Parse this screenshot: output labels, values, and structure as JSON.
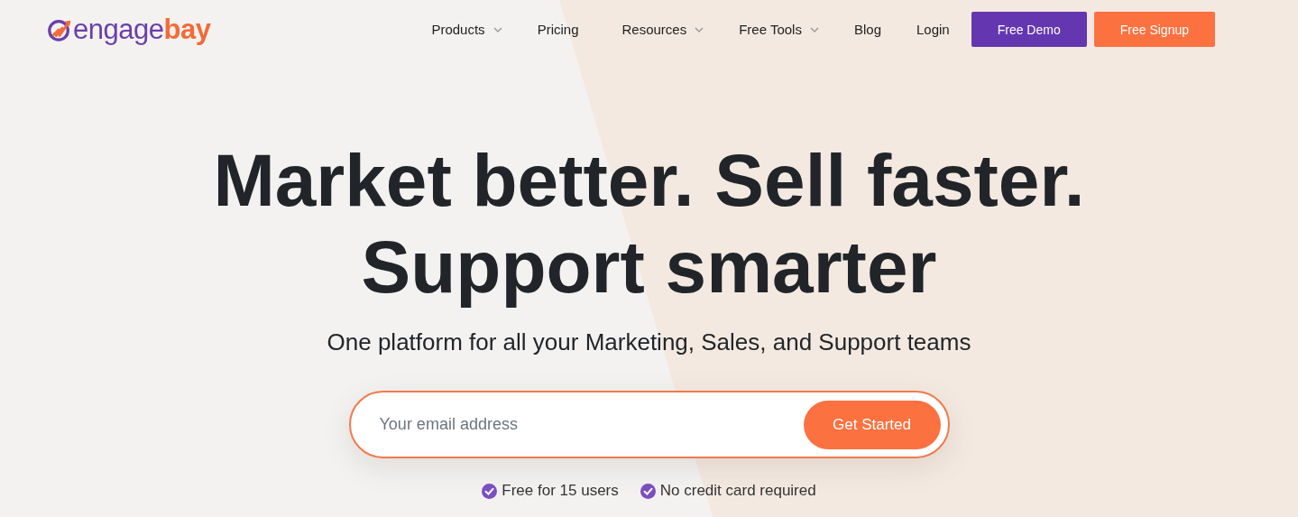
{
  "logo": {
    "first": "engage",
    "second": "bay"
  },
  "nav": [
    {
      "label": "Products",
      "kind": "dropdown"
    },
    {
      "label": "Pricing",
      "kind": "link"
    },
    {
      "label": "Resources",
      "kind": "dropdown"
    },
    {
      "label": "Free Tools",
      "kind": "dropdown"
    },
    {
      "label": "Blog",
      "kind": "link"
    },
    {
      "label": "Login",
      "kind": "link"
    }
  ],
  "buttons": [
    {
      "label": "Free Demo",
      "kind": "demo"
    },
    {
      "label": "Free Signup",
      "kind": "signup"
    }
  ],
  "hero": {
    "headline": [
      "Market better. Sell faster.",
      "Support smarter"
    ],
    "subtitle": "One platform for all your Marketing, Sales, and Support teams"
  },
  "signup_form": {
    "placeholder": "Your email address",
    "button": "Get Started"
  },
  "perks": [
    "Free for 15 users",
    "No credit card required"
  ]
}
